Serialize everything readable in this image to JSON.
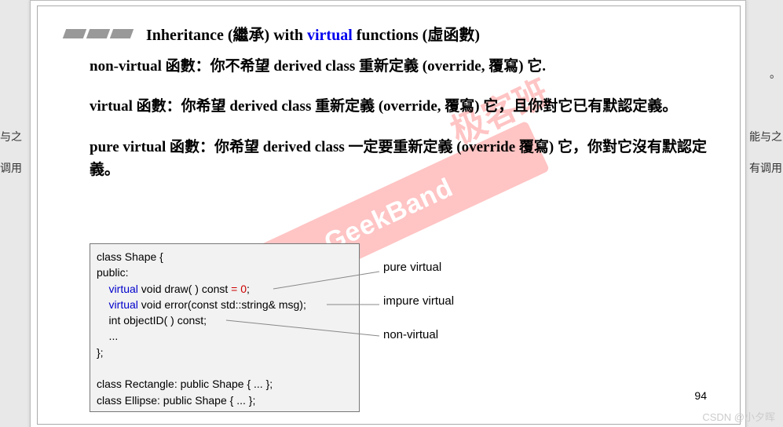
{
  "background_text": {
    "left1": "与之",
    "left2": "调用",
    "right0": "。",
    "right1": "能与之",
    "right2": "有调用"
  },
  "heading": {
    "pre": "Inheritance (繼承) with ",
    "blue": "virtual",
    "post": " functions (虛函數)"
  },
  "body": {
    "p1": "non-virtual 函數：你不希望 derived class 重新定義 (override, 覆寫) 它.",
    "p2": "virtual 函數：你希望 derived class 重新定義 (override, 覆寫) 它，且你對它已有默認定義。",
    "p3": "pure virtual 函數：你希望 derived class 一定要重新定義 (override 覆寫) 它，你對它沒有默認定義。"
  },
  "code": {
    "l1": "class Shape {",
    "l2": "public:",
    "l3_kw": "    virtual",
    "l3_mid": " void draw( ) const ",
    "l3_pv": "= 0",
    "l3_end": ";",
    "l4_kw": "    virtual",
    "l4_rest": " void error(const std::string& msg);",
    "l5": "    int objectID( ) const;",
    "l6": "    ...",
    "l7": "};",
    "l8": "",
    "l9": "class Rectangle: public Shape { ... };",
    "l10": "class Ellipse: public Shape { ... };"
  },
  "labels": {
    "pure": "pure virtual",
    "impure": "impure virtual",
    "nonv": "non-virtual"
  },
  "watermark": {
    "en": "GeekBand",
    "cn": "极客班"
  },
  "page_number": "94",
  "csdn": "CSDN @小夕晖"
}
